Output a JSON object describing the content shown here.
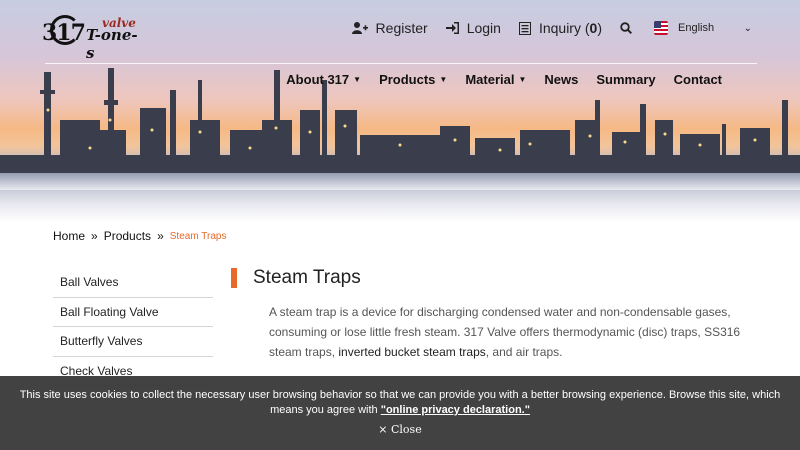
{
  "logo": {
    "number": "317",
    "valve": "valve",
    "tones": "T-one-s"
  },
  "topbar": {
    "register": "Register",
    "login": "Login",
    "inquiry_label": "Inquiry (",
    "inquiry_count": "0",
    "inquiry_close": ")",
    "language": "English"
  },
  "mainnav": [
    "About 317",
    "Products",
    "Material",
    "News",
    "Summary",
    "Contact"
  ],
  "breadcrumb": {
    "home": "Home",
    "products": "Products",
    "current": "Steam Traps"
  },
  "sidebar": [
    "Ball Valves",
    "Ball Floating Valve",
    "Butterfly Valves",
    "Check Valves"
  ],
  "content": {
    "title": "Steam Traps",
    "desc_1": "A steam trap is a device for discharging condensed water and non-condensable gases, consuming or lose little fresh steam. 317 Valve offers thermodynamic (disc) traps, SS316 steam traps, ",
    "desc_link": "inverted bucket steam traps",
    "desc_2": ", and air traps."
  },
  "cookie": {
    "message": "This site uses cookies to collect the necessary user browsing behavior so that we can provide you with a better browsing experience. Browse this site, which means you agree with ",
    "link": "\"online privacy declaration.\"",
    "close": "× Close"
  },
  "colors": {
    "accent": "#e76a2b",
    "cookie_bg": "#323232"
  }
}
